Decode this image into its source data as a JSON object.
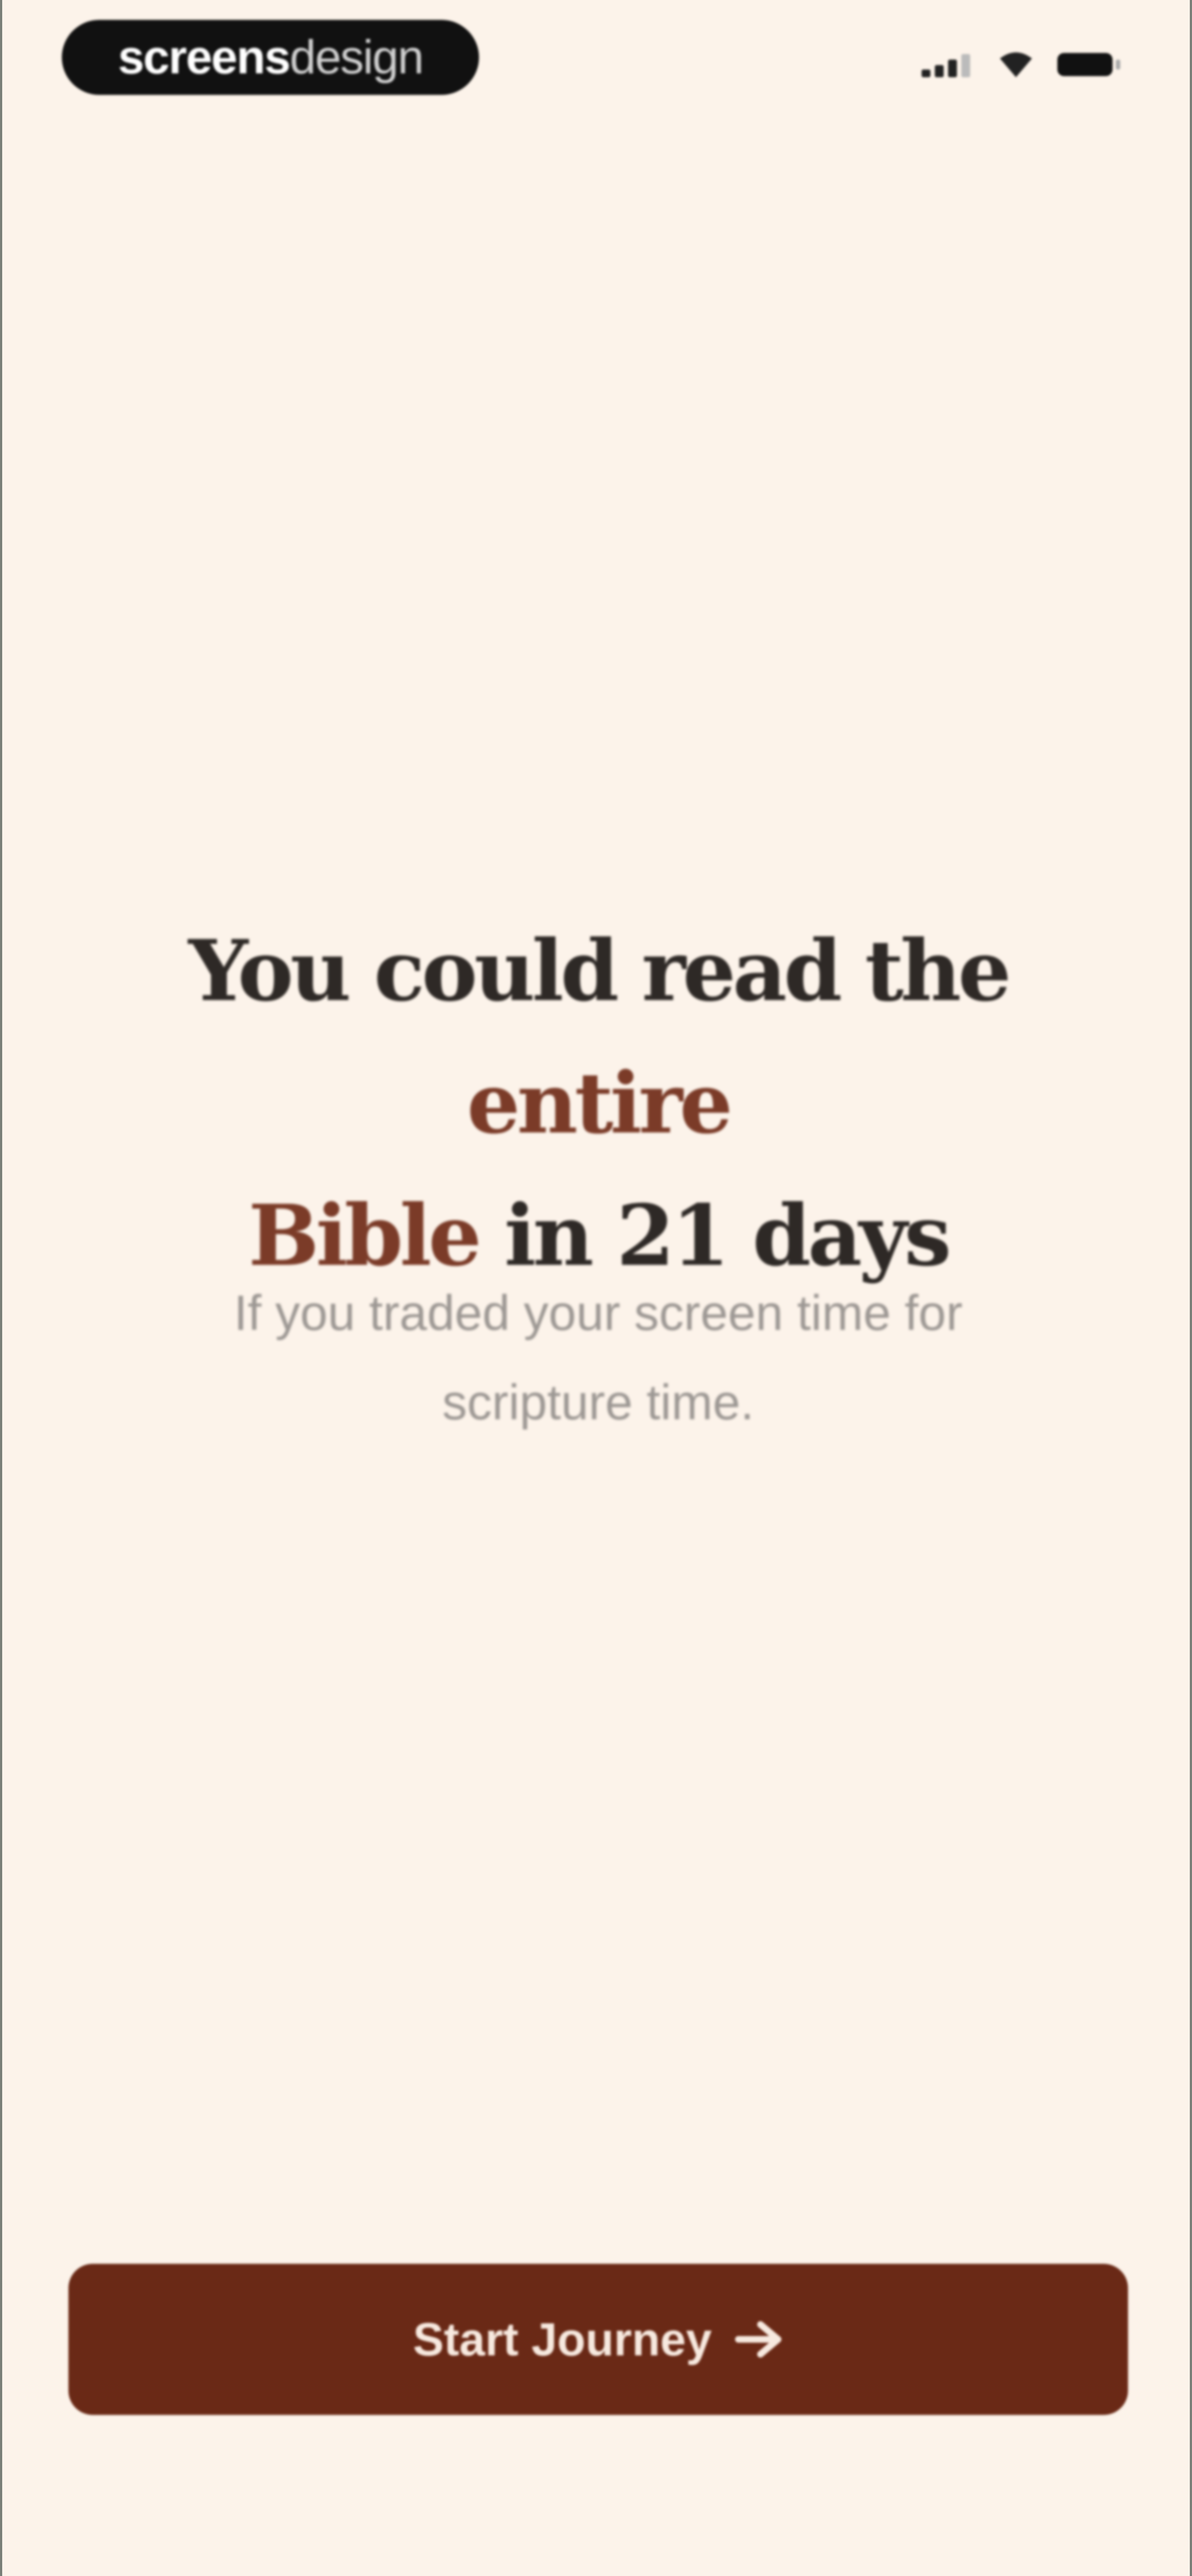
{
  "status_bar": {
    "brand_bold": "screens",
    "brand_light": "design",
    "icons": [
      "signal-icon",
      "wifi-icon",
      "battery-icon"
    ]
  },
  "headline": {
    "part1": "You could read the ",
    "accent1": "entire",
    "accent2": "Bible",
    "part2": " in 21 days"
  },
  "subtitle": {
    "line1": "If you traded your screen time for",
    "line2": "scripture time."
  },
  "cta": {
    "label": "Start Journey",
    "icon": "arrow-right-icon"
  },
  "colors": {
    "background": "#fcf3ea",
    "accent": "#7b3b28",
    "button": "#6a2916",
    "heading": "#2e2926",
    "muted": "#9d9894"
  }
}
